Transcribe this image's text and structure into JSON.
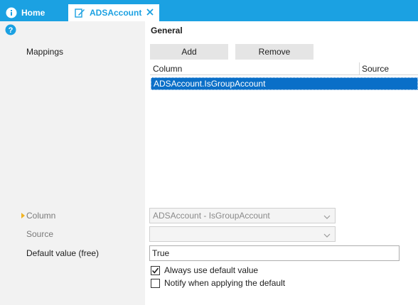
{
  "tabs": [
    {
      "label": "Home",
      "icon": "info-icon"
    },
    {
      "label": "ADSAccount",
      "icon": "edit-document-icon",
      "close_icon": "close-icon"
    }
  ],
  "colors": {
    "accent": "#1ba1e2",
    "selection": "#0a6fc8",
    "left_bg": "#f2f2f2"
  },
  "section": {
    "title": "General"
  },
  "labels": {
    "mappings": "Mappings",
    "column": "Column",
    "source": "Source",
    "default_value": "Default value (free)"
  },
  "mappings": {
    "add_label": "Add",
    "remove_label": "Remove",
    "headers": [
      "Column",
      "Source"
    ],
    "rows": [
      {
        "column": "ADSAccount.IsGroupAccount",
        "source": ""
      }
    ]
  },
  "fields": {
    "column_value": "ADSAccount - IsGroupAccount",
    "source_value": "",
    "default_value": "True"
  },
  "checkboxes": [
    {
      "label": "Always use default value",
      "checked": true
    },
    {
      "label": "Notify when applying the default",
      "checked": false
    }
  ]
}
